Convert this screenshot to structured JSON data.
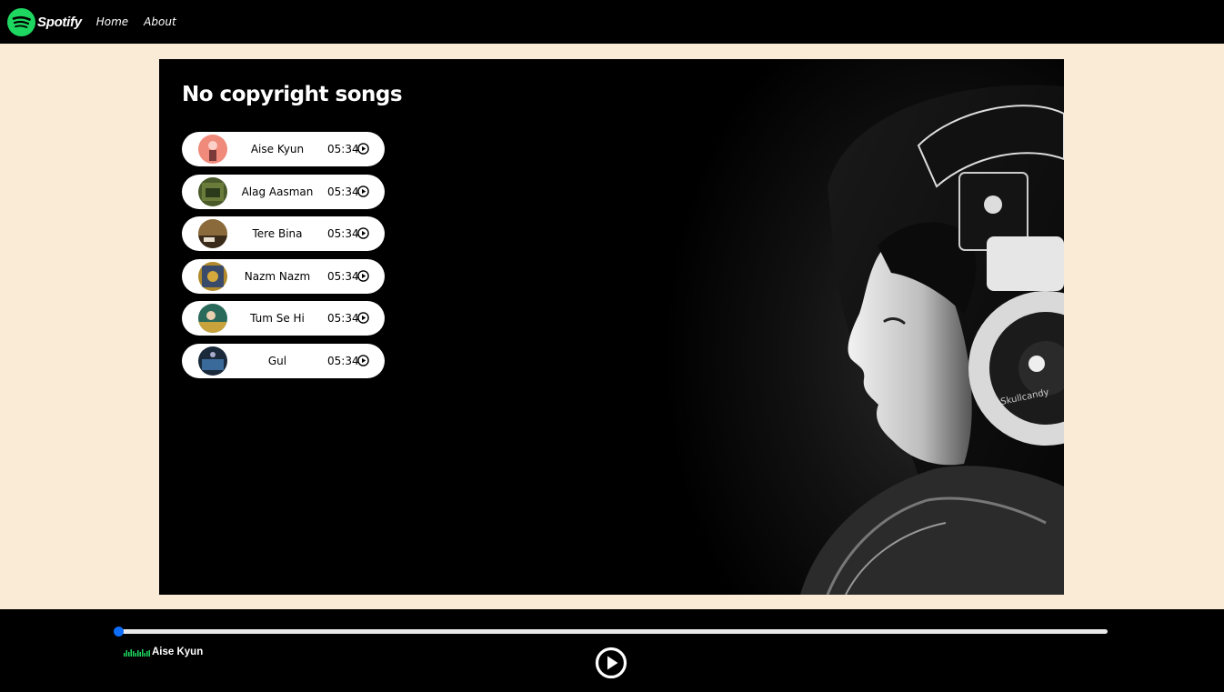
{
  "nav": {
    "brand": "Spotify",
    "links": [
      "Home",
      "About"
    ]
  },
  "main": {
    "title": "No copyright songs",
    "songs": [
      {
        "name": "Aise Kyun",
        "duration": "05:34",
        "cover_color": "#f08a7a"
      },
      {
        "name": "Alag Aasman",
        "duration": "05:34",
        "cover_color": "#4a5a2a"
      },
      {
        "name": "Tere Bina",
        "duration": "05:34",
        "cover_color": "#8a6a3a"
      },
      {
        "name": "Nazm Nazm",
        "duration": "05:34",
        "cover_color": "#b08a2a"
      },
      {
        "name": "Tum Se Hi",
        "duration": "05:34",
        "cover_color": "#2a6a5a"
      },
      {
        "name": "Gul",
        "duration": "05:34",
        "cover_color": "#1a3a5a"
      }
    ]
  },
  "player": {
    "now_playing": "Aise Kyun",
    "progress_percent": 0,
    "accent_color": "#0d6efd"
  },
  "icons": {
    "logo": "spotify-logo-icon",
    "song_play": "play-circle-icon",
    "master_play": "play-circle-icon",
    "equalizer": "equalizer-icon"
  }
}
